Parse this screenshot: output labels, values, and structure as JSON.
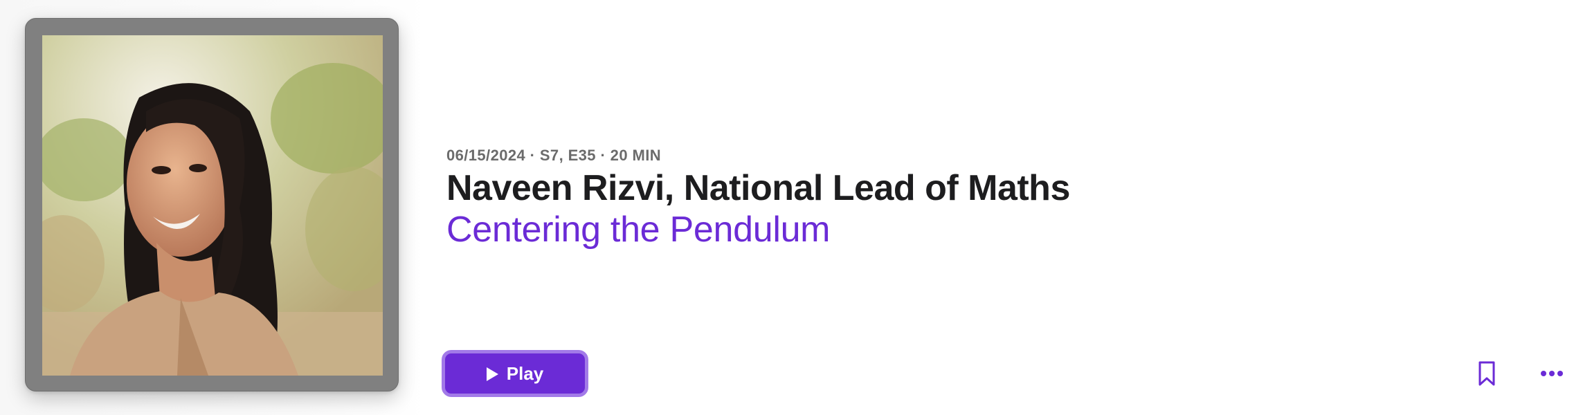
{
  "episode": {
    "meta": "06/15/2024 · S7, E35 · 20 MIN",
    "title": "Naveen Rizvi, National Lead of Maths",
    "show": "Centering the Pendulum"
  },
  "actions": {
    "play_label": "Play"
  },
  "icons": {
    "play": "play-icon",
    "bookmark": "bookmark-icon",
    "more": "ellipsis-icon"
  },
  "colors": {
    "accent": "#6b2bd6",
    "accent_outline": "#a27ae8",
    "title": "#1d1d1f",
    "meta": "#6b6b6b",
    "artwork_frame": "#808080"
  }
}
